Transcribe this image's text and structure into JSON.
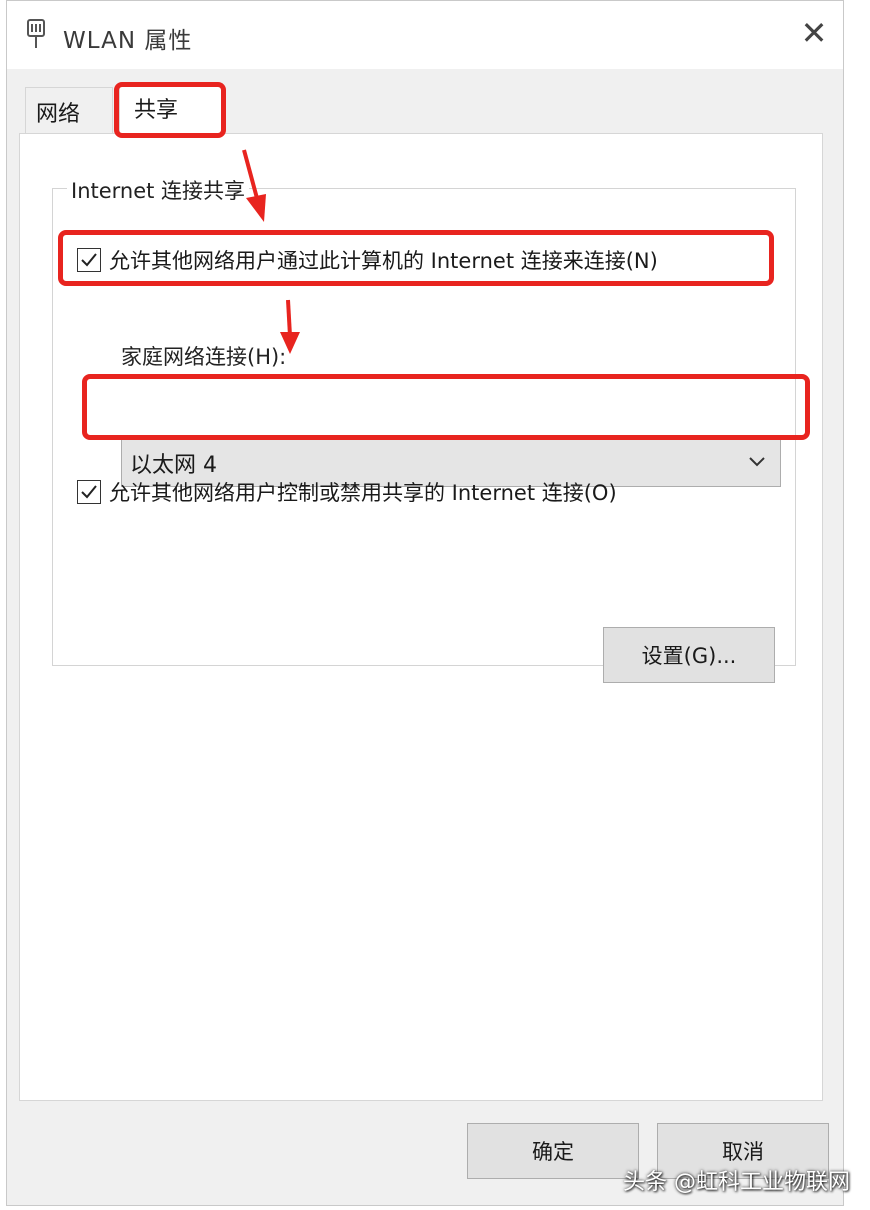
{
  "window": {
    "title": "WLAN 属性",
    "close_glyph": "✕"
  },
  "tabs": [
    {
      "label": "网络",
      "selected": false
    },
    {
      "label": "共享",
      "selected": true
    }
  ],
  "group": {
    "title": "Internet 连接共享",
    "allow_sharing": {
      "label": "允许其他网络用户通过此计算机的 Internet 连接来连接(N)",
      "checked": true
    },
    "home_network_label": "家庭网络连接(H):",
    "home_network_value": "以太网 4",
    "allow_control": {
      "label": "允许其他网络用户控制或禁用共享的 Internet 连接(O)",
      "checked": true
    },
    "settings_button": "设置(G)..."
  },
  "footer": {
    "ok_button": "确定",
    "cancel_button": "取消"
  },
  "watermark": "头条 @虹科工业物联网",
  "colors": {
    "highlight": "#e8241f",
    "button_bg": "#e1e1e1",
    "panel_bg": "#ffffff",
    "window_bg": "#f0f0f0"
  }
}
